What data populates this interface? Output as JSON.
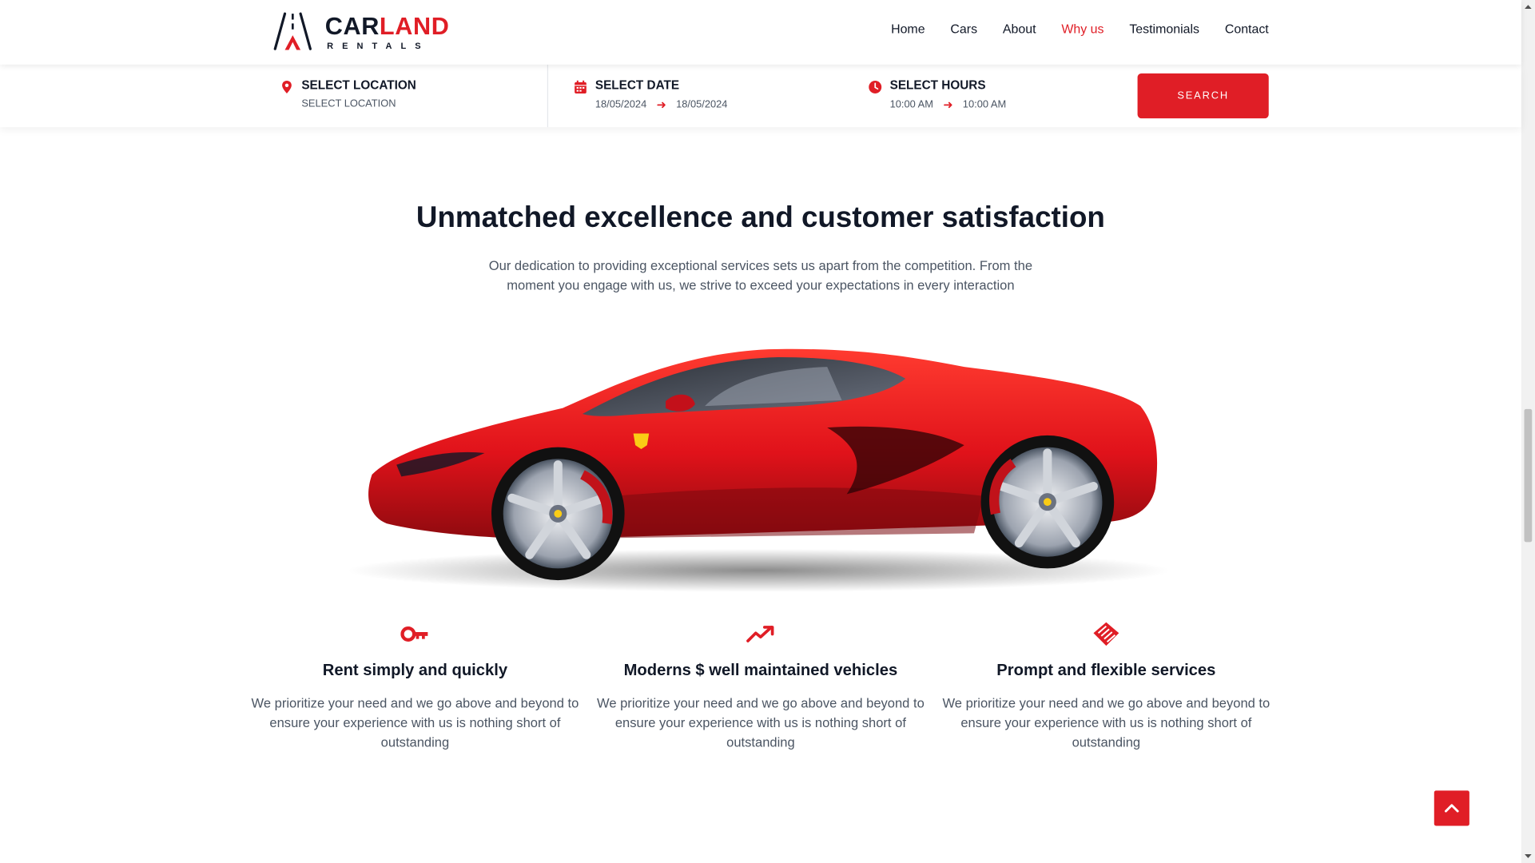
{
  "brand": {
    "word_a": "CAR",
    "word_b": "LAND",
    "sub": "RENTALS"
  },
  "nav": {
    "items": [
      {
        "label": "Home",
        "active": false
      },
      {
        "label": "Cars",
        "active": false
      },
      {
        "label": "About",
        "active": false
      },
      {
        "label": "Why us",
        "active": true
      },
      {
        "label": "Testimonials",
        "active": false
      },
      {
        "label": "Contact",
        "active": false
      }
    ]
  },
  "search": {
    "location": {
      "label": "SELECT LOCATION",
      "value": "SELECT LOCATION"
    },
    "date": {
      "label": "SELECT DATE",
      "from": "18/05/2024",
      "to": "18/05/2024"
    },
    "hours": {
      "label": "SELECT HOURS",
      "from": "10:00 AM",
      "to": "10:00 AM"
    },
    "button": "SEARCH"
  },
  "section": {
    "title": "Unmatched excellence and customer satisfaction",
    "lead": "Our dedication to providing exceptional services sets us apart from the competition. From the moment you engage with us, we strive to exceed your expectations in every interaction"
  },
  "features": [
    {
      "icon": "key-icon",
      "title": "Rent simply and quickly",
      "text": "We prioritize your need and we go above and beyond to ensure your experience with us is nothing short of outstanding"
    },
    {
      "icon": "trending-up-icon",
      "title": "Moderns $ well maintained vehicles",
      "text": "We prioritize your need and we go above and beyond to ensure your experience with us is nothing short of outstanding"
    },
    {
      "icon": "handshake-icon",
      "title": "Prompt and flexible services",
      "text": "We prioritize your need and we go above and beyond to ensure your experience with us is nothing short of outstanding"
    }
  ],
  "colors": {
    "accent": "#e01e26",
    "text": "#111827",
    "muted": "#4b5563"
  }
}
